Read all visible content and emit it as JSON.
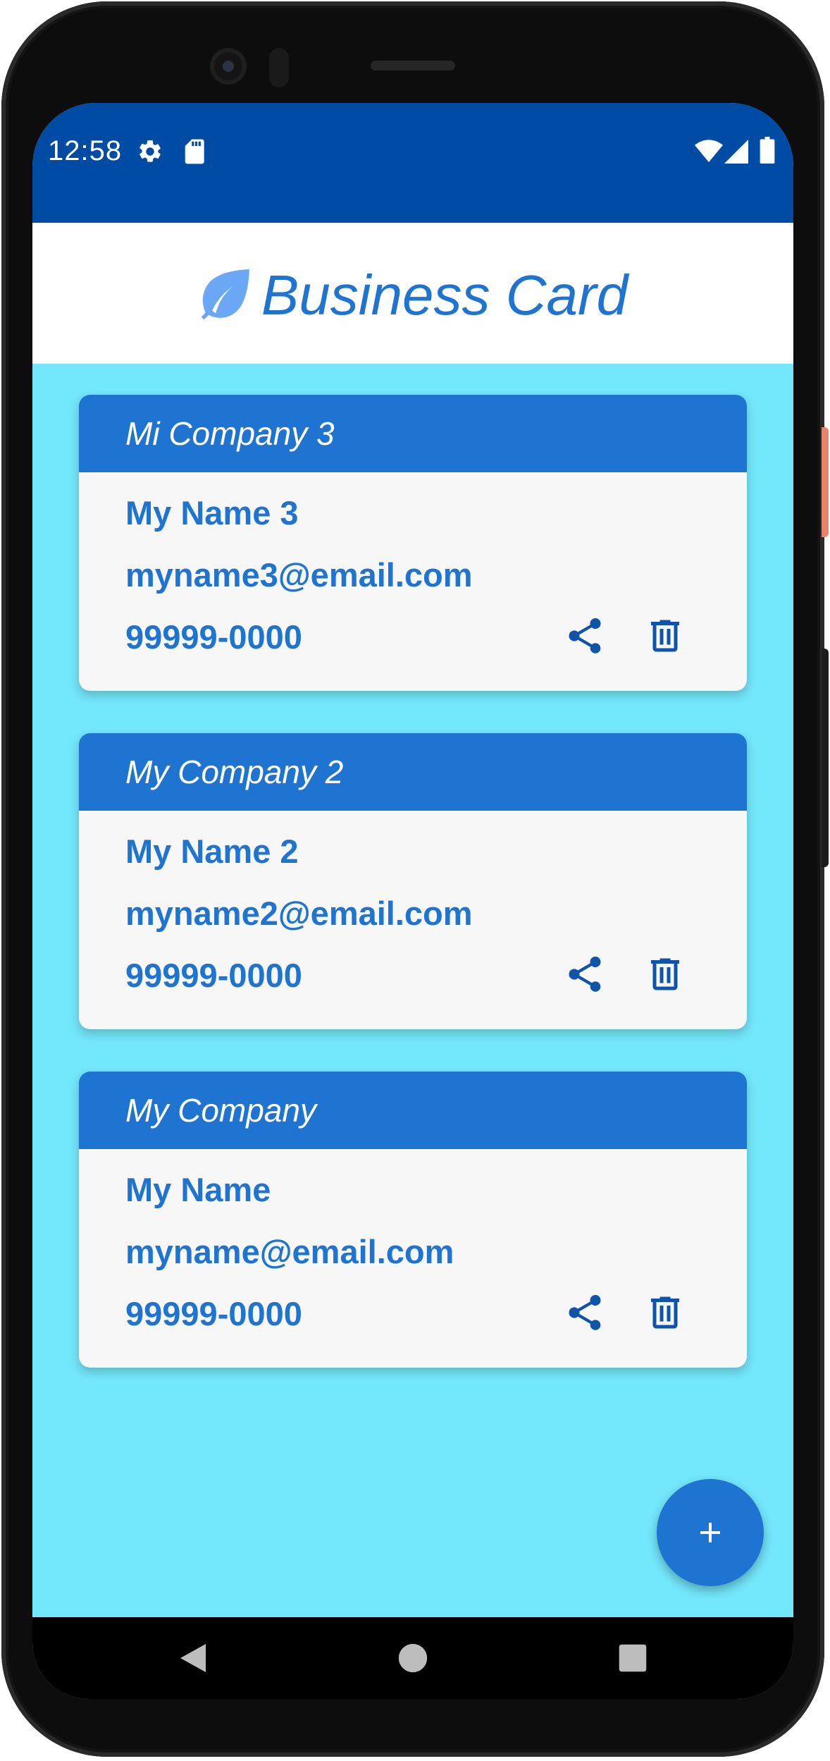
{
  "status_bar": {
    "time": "12:58",
    "icons_left": [
      "gear-icon",
      "sd-card-icon"
    ],
    "icons_right": [
      "wifi-icon",
      "signal-icon",
      "battery-icon"
    ],
    "color": "#004ba3"
  },
  "app_bar": {
    "title": "Business Card",
    "logo_icon": "leaf-icon",
    "title_color": "#1e74d0",
    "logo_color": "#6aa8f5"
  },
  "theme": {
    "background": "#73e7fb",
    "card_header": "#1e74d0",
    "card_text": "#1e74d0",
    "card_body": "#f7f7f7",
    "icon_color": "#0f54a8"
  },
  "cards": [
    {
      "company": "Mi Company 3",
      "name": "My Name 3",
      "email": "myname3@email.com",
      "phone": "99999-0000"
    },
    {
      "company": "My Company 2",
      "name": "My Name 2",
      "email": "myname2@email.com",
      "phone": "99999-0000"
    },
    {
      "company": "My Company",
      "name": "My Name",
      "email": "myname@email.com",
      "phone": "99999-0000"
    }
  ],
  "card_actions": [
    "share-icon",
    "delete-icon"
  ],
  "fab": {
    "icon": "plus-icon"
  },
  "nav_bar": {
    "buttons": [
      "back-icon",
      "home-icon",
      "recents-icon"
    ]
  }
}
